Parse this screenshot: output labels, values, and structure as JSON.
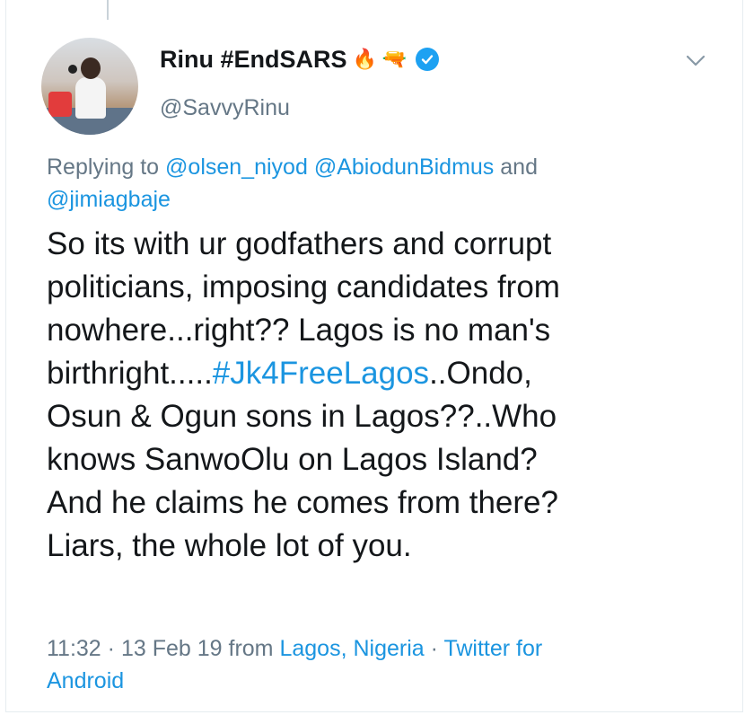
{
  "tweet": {
    "display_name": "Rinu #EndSARS",
    "name_emojis": [
      "🔥",
      "🔫"
    ],
    "handle": "@SavvyRinu",
    "replying_prefix": "Replying to",
    "mentions": [
      "@olsen_niyod",
      "@AbiodunBidmus",
      "@jimiagbaje"
    ],
    "mentions_joiner": "and",
    "text_lines": [
      "So its with ur godfathers and corrupt",
      "politicians, imposing candidates from",
      "nowhere...right?? Lagos is no man's",
      "birthright.....",
      "Osun & Ogun sons in Lagos??..Who",
      "knows SanwoOlu on Lagos Island?",
      "And he claims he comes from there?",
      "Liars, the whole lot of you."
    ],
    "hashtag": "#Jk4FreeLagos",
    "after_hashtag": "..Ondo,",
    "time": "11:32",
    "date": "13 Feb 19",
    "from_word": "from",
    "location": "Lagos, Nigeria",
    "source_line1": "Twitter for",
    "source_line2": "Android",
    "separator": "·"
  },
  "icons": {
    "verified": "verified-badge-icon",
    "chevron": "chevron-down-icon"
  },
  "colors": {
    "link": "#1b95e0",
    "muted": "#657786",
    "text": "#14171a",
    "verified": "#1da1f2"
  }
}
